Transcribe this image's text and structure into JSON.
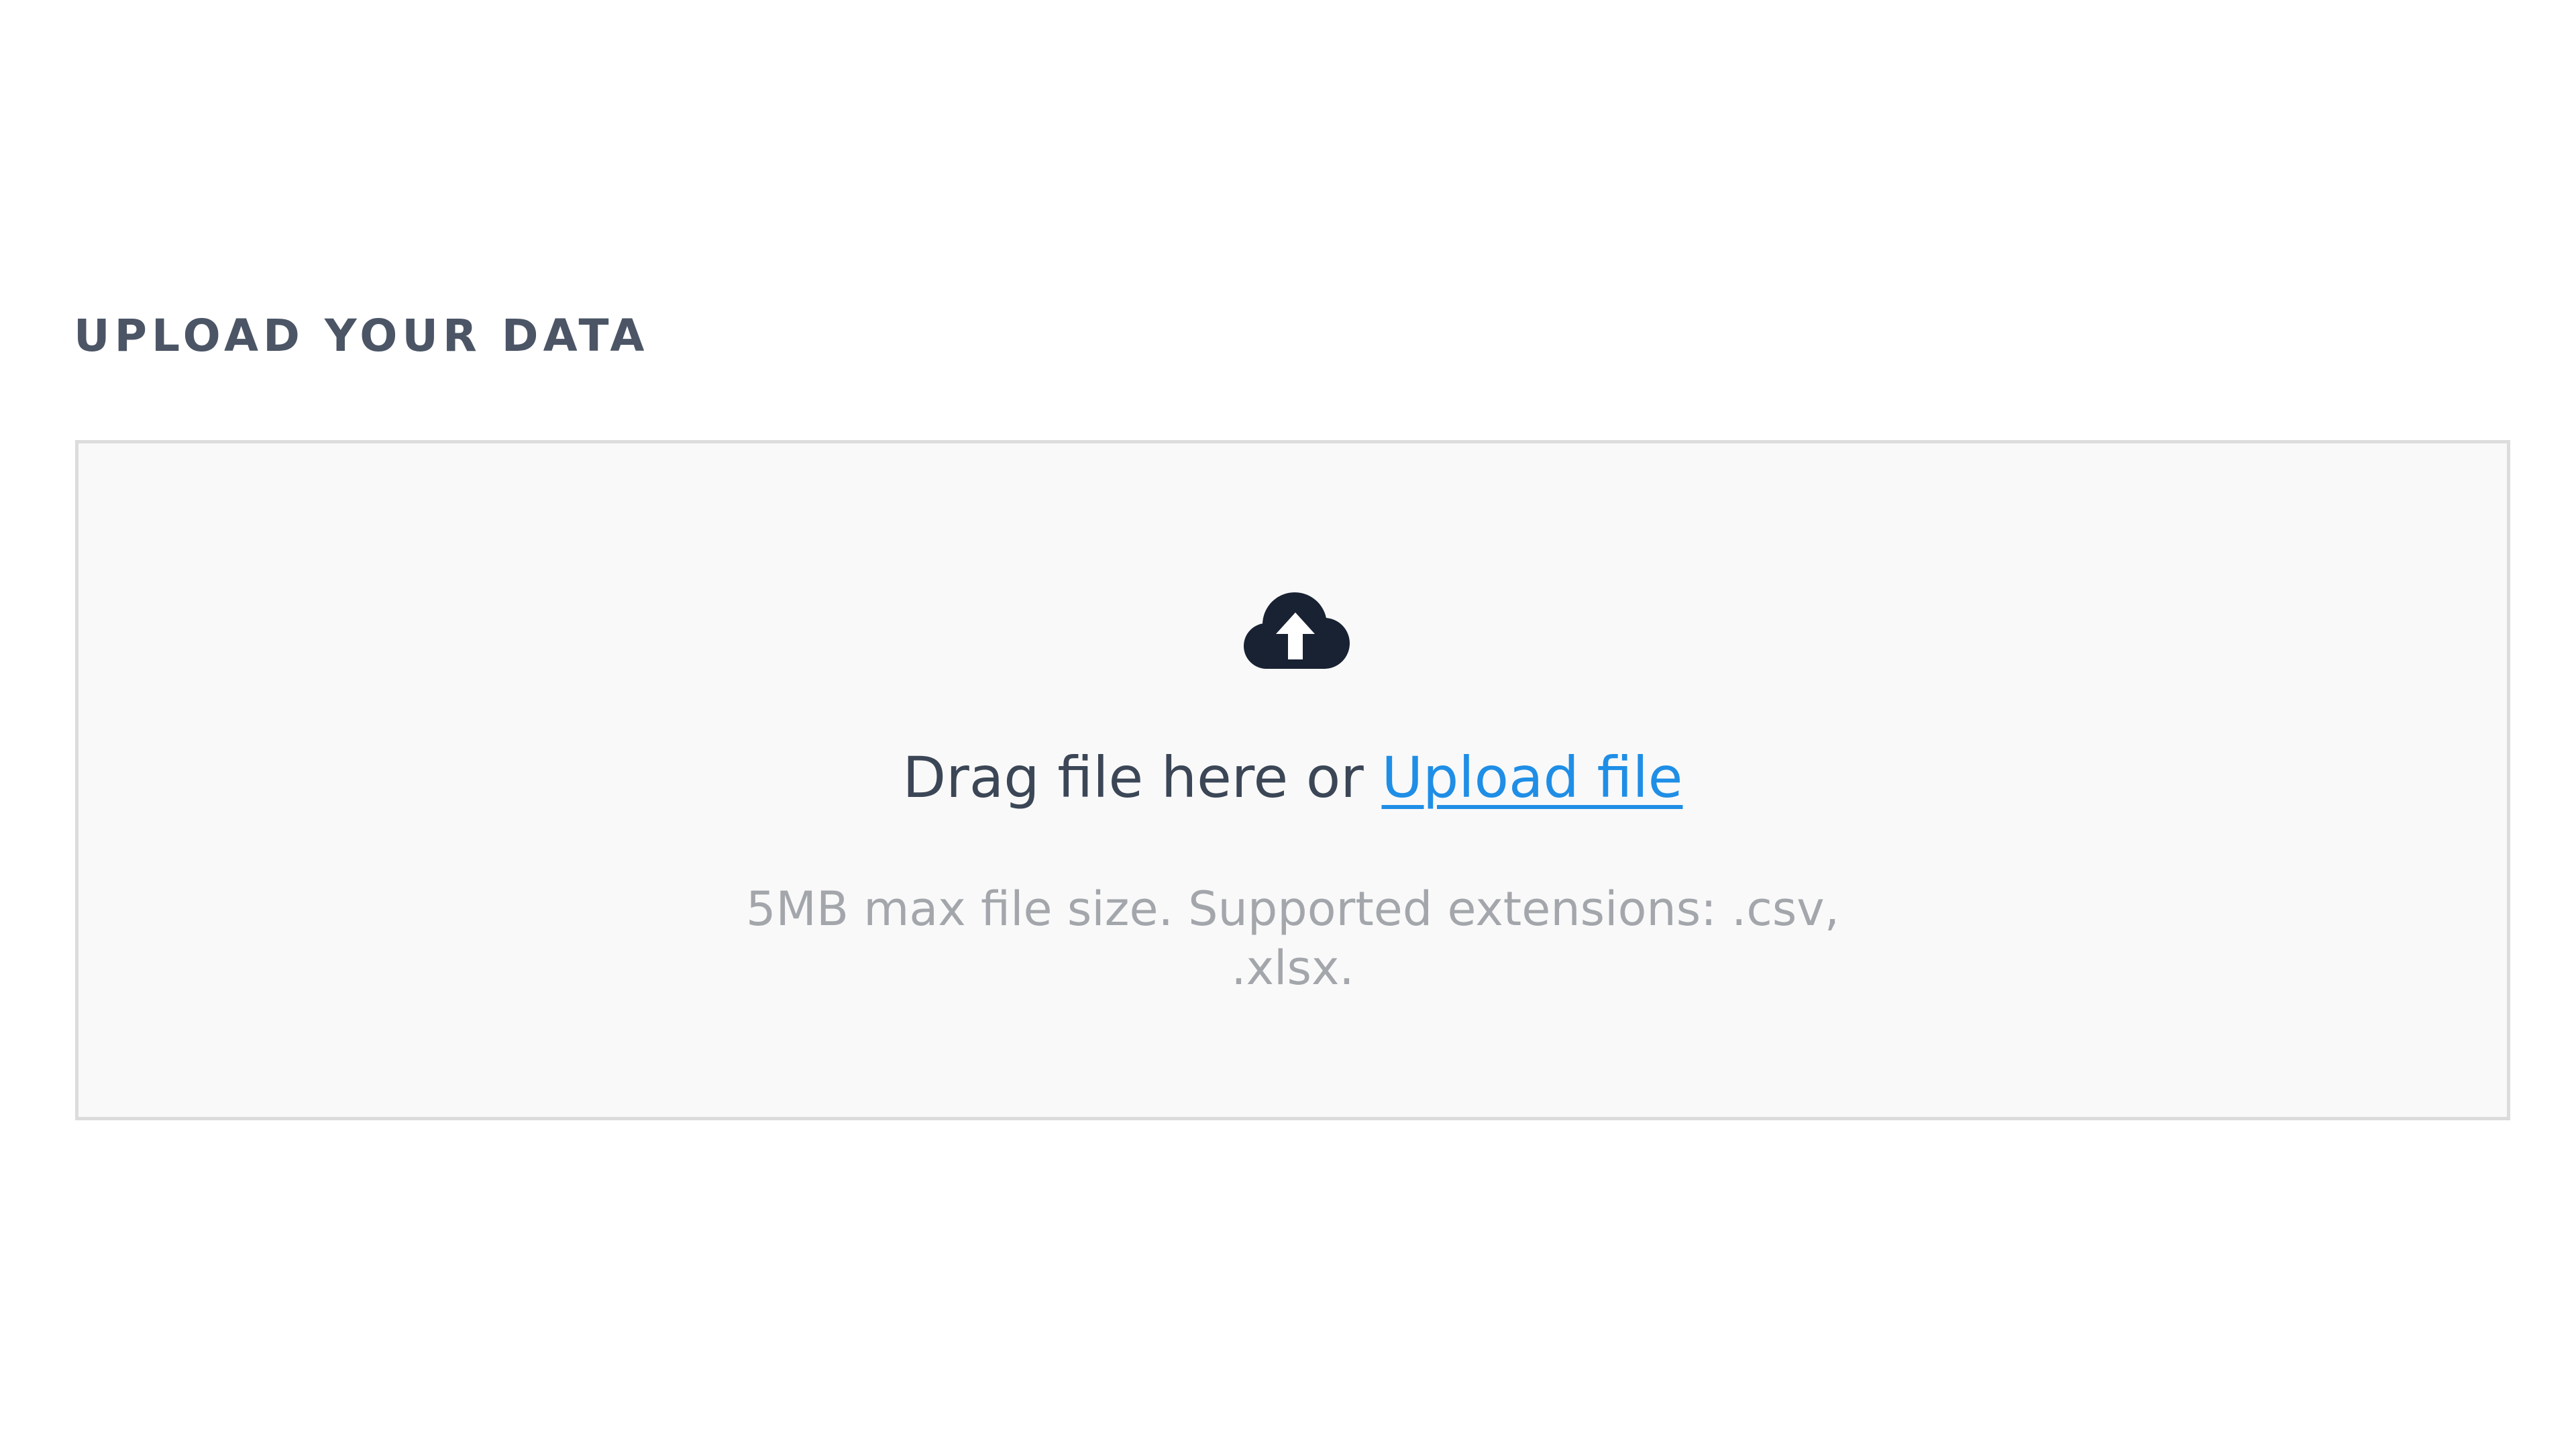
{
  "section": {
    "title": "UPLOAD YOUR DATA"
  },
  "dropzone": {
    "icon": "cloud-upload-icon",
    "prompt_text": "Drag file here or ",
    "upload_link_label": "Upload file",
    "hint_line1": "5MB max file size. Supported extensions: .csv,",
    "hint_line2": ".xlsx."
  },
  "colors": {
    "title": "#4b5566",
    "dropzone_bg": "#f9f9f9",
    "dropzone_border": "#dcdcdc",
    "icon": "#182233",
    "prompt_text": "#3b4656",
    "link": "#1f8ee6",
    "hint_text": "#a3a6ab"
  }
}
